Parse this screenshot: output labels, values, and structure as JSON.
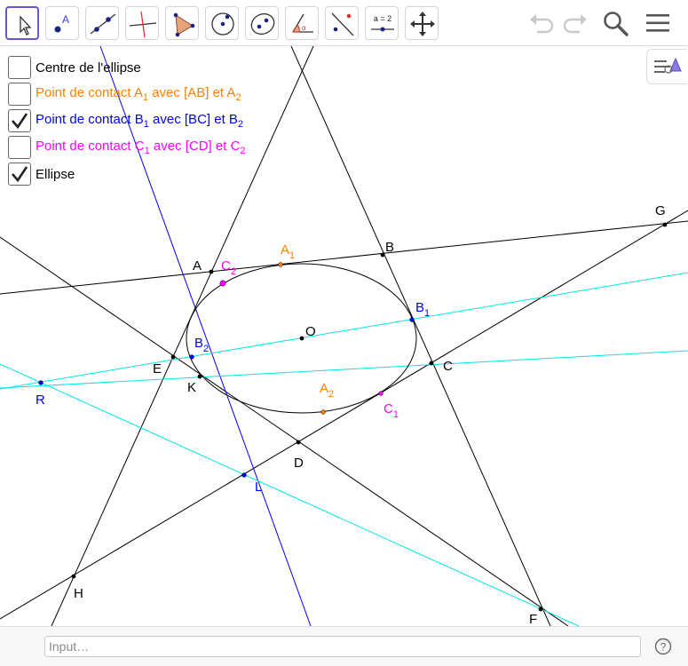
{
  "toolbar": {
    "tools": [
      {
        "name": "move-tool",
        "icon": "arrow-cursor-icon",
        "selected": true
      },
      {
        "name": "point-tool",
        "icon": "point-icon"
      },
      {
        "name": "line-tool",
        "icon": "line-icon"
      },
      {
        "name": "perpendicular-line-tool",
        "icon": "perpendicular-line-icon"
      },
      {
        "name": "polygon-tool",
        "icon": "polygon-icon"
      },
      {
        "name": "circle-tool",
        "icon": "circle-icon"
      },
      {
        "name": "ellipse-tool",
        "icon": "ellipse-icon"
      },
      {
        "name": "angle-tool",
        "icon": "angle-icon"
      },
      {
        "name": "reflect-tool",
        "icon": "reflect-icon"
      },
      {
        "name": "slider-tool",
        "icon": "slider-icon",
        "label": "a = 2"
      },
      {
        "name": "move-view-tool",
        "icon": "move-graphics-view-icon"
      }
    ],
    "right_buttons": [
      "undo-icon",
      "redo-icon",
      "search-icon",
      "menu-icon"
    ]
  },
  "checkboxes": [
    {
      "checked": false,
      "color": "#000000",
      "parts": [
        "Centre de l'ellipse"
      ]
    },
    {
      "checked": false,
      "color": "#ff8000",
      "parts": [
        "Point de contact A",
        "1",
        " avec [AB] et A",
        "2"
      ]
    },
    {
      "checked": true,
      "color": "#0000ff",
      "parts": [
        "Point de contact B",
        "1",
        " avec [BC] et B",
        "2"
      ]
    },
    {
      "checked": false,
      "color": "#ff00ff",
      "parts": [
        "Point de contact C",
        "1",
        " avec [CD] et C",
        "2"
      ]
    },
    {
      "checked": true,
      "color": "#000000",
      "parts": [
        "Ellipse"
      ]
    }
  ],
  "points": [
    {
      "main": "A",
      "sub": "",
      "color": "#000000"
    },
    {
      "main": "B",
      "sub": "",
      "color": "#000000"
    },
    {
      "main": "C",
      "sub": "",
      "color": "#000000"
    },
    {
      "main": "D",
      "sub": "",
      "color": "#000000"
    },
    {
      "main": "E",
      "sub": "",
      "color": "#000000"
    },
    {
      "main": "F",
      "sub": "",
      "color": "#000000"
    },
    {
      "main": "G",
      "sub": "",
      "color": "#000000"
    },
    {
      "main": "H",
      "sub": "",
      "color": "#000000"
    },
    {
      "main": "K",
      "sub": "",
      "color": "#000000"
    },
    {
      "main": "O",
      "sub": "",
      "color": "#000000"
    },
    {
      "main": "L",
      "sub": "",
      "color": "#0000ff"
    },
    {
      "main": "R",
      "sub": "",
      "color": "#0000ff"
    },
    {
      "main": "A",
      "sub": "1",
      "color": "#ff8000"
    },
    {
      "main": "A",
      "sub": "2",
      "color": "#ff8000"
    },
    {
      "main": "B",
      "sub": "1",
      "color": "#0000ff"
    },
    {
      "main": "B",
      "sub": "2",
      "color": "#0000ff"
    },
    {
      "main": "C",
      "sub": "1",
      "color": "#ff00ff"
    },
    {
      "main": "C",
      "sub": "2",
      "color": "#ff00ff"
    }
  ],
  "input_bar": {
    "placeholder": "Input…"
  },
  "help_icon": "help-icon",
  "colors": {
    "selected_tool": "#6557d2",
    "line": "#000000",
    "blue_line": "#0000ff",
    "cyan_line": "#00e5e5"
  }
}
